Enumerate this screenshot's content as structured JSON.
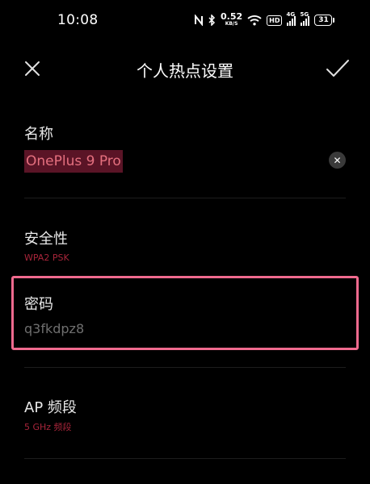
{
  "status_bar": {
    "time": "10:08",
    "net_speed_value": "0.52",
    "net_speed_unit": "KB/S",
    "hd_badge": "HD",
    "sim1_label": "4G",
    "sim2_label": "5G",
    "battery_level": "31"
  },
  "header": {
    "title": "个人热点设置"
  },
  "fields": {
    "name_label": "名称",
    "name_value": "OnePlus 9 Pro",
    "security_label": "安全性",
    "security_value": "WPA2 PSK",
    "password_label": "密码",
    "password_value": "q3fkdpz8",
    "band_label": "AP 频段",
    "band_value": "5 GHz 频段"
  },
  "colors": {
    "accent": "#a8253a",
    "selection_bg": "#5a1426",
    "highlight_border": "#f06a8e"
  }
}
